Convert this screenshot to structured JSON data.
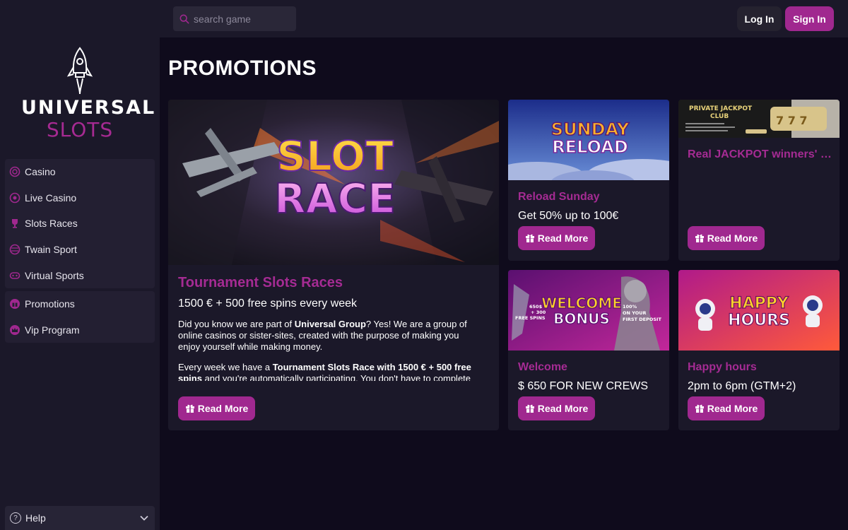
{
  "search": {
    "placeholder": "search game"
  },
  "header": {
    "login_label": "Log In",
    "signin_label": "Sign In"
  },
  "brand": {
    "line1": "UNIVERSAL",
    "line2": "SLOTS"
  },
  "sidebar": {
    "items": [
      {
        "label": "Casino",
        "icon": "casino-chip-icon"
      },
      {
        "label": "Live Casino",
        "icon": "live-casino-icon"
      },
      {
        "label": "Slots Races",
        "icon": "trophy-icon"
      },
      {
        "label": "Twain Sport",
        "icon": "sport-ball-icon"
      },
      {
        "label": "Virtual Sports",
        "icon": "gamepad-icon"
      }
    ],
    "items2": [
      {
        "label": "Promotions",
        "icon": "gift-icon"
      },
      {
        "label": "Vip Program",
        "icon": "crown-icon"
      }
    ],
    "help_label": "Help"
  },
  "main": {
    "title": "PROMOTIONS",
    "featured": {
      "image_text1": "SLOT",
      "image_text2": "RACE",
      "title": "Tournament Slots Races",
      "subtitle": "1500 € + 500 free spins every week",
      "p1_a": "Did you know we are part of ",
      "p1_b": "Universal Group",
      "p1_c": "? Yes! We are a group of online casinos or sister-sites, created with the purpose of making you enjoy yourself while making money.",
      "p2_a": "Every week we have a ",
      "p2_b": "Tournament Slots Race with 1500 € + 500 free spins",
      "p2_c": " and you're automatically participating. You don't have to complete",
      "button": "Read More"
    },
    "cards": [
      {
        "image_text1": "SUNDAY",
        "image_text2": "RELOAD",
        "title": "Reload Sunday",
        "subtitle": "Get 50% up to 100€",
        "button": "Read More"
      },
      {
        "image_text1": "PRIVATE JACKPOT",
        "image_text2": "CLUB",
        "title": "Real JACKPOT winners' club",
        "subtitle": "",
        "button": "Read More"
      },
      {
        "image_text1": "WELCOME",
        "image_text2": "BONUS",
        "image_left": "650$ + 300 FREE SPINS",
        "image_right": "100% ON YOUR FIRST DEPOSIT",
        "title": "Welcome",
        "subtitle": "$ 650 FOR NEW CREWS",
        "button": "Read More"
      },
      {
        "image_text1": "HAPPY",
        "image_text2": "HOURS",
        "title": "Happy hours",
        "subtitle": "2pm to 6pm (GTM+2)",
        "button": "Read More"
      }
    ]
  },
  "colors": {
    "accent": "#a0288f",
    "accent_text": "#a52b93",
    "page_bg": "#0f0b1c",
    "panel_bg": "#1b1829"
  }
}
